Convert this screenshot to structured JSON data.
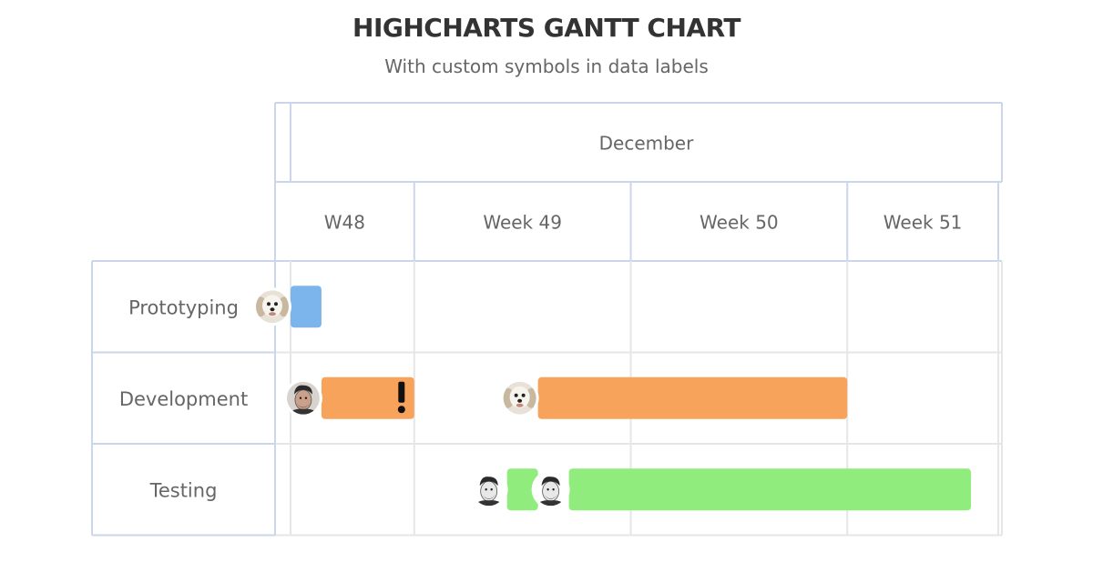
{
  "title": "HIGHCHARTS GANTT CHART",
  "subtitle": "With custom symbols in data labels",
  "chart_data": {
    "type": "gantt",
    "title": "HIGHCHARTS GANTT CHART",
    "subtitle": "With custom symbols in data labels",
    "month_label": "December",
    "week_labels": [
      "W48",
      "Week 49",
      "Week 50",
      "Week 51"
    ],
    "categories": [
      "Prototyping",
      "Development",
      "Testing"
    ],
    "grid": true,
    "x_range": [
      "2022-11-30T12:00",
      "2022-12-24T00:00"
    ],
    "tasks": [
      {
        "category": "Prototyping",
        "start": "2022-12-01",
        "end": "2022-12-02",
        "color": "#7cb5ec",
        "label_symbol": "dog-avatar-icon"
      },
      {
        "category": "Development",
        "start": "2022-12-02",
        "end": "2022-12-05",
        "color": "#f7a35c",
        "label_symbol": "man-avatar-icon",
        "end_symbol": "exclamation-icon"
      },
      {
        "category": "Development",
        "start": "2022-12-09",
        "end": "2022-12-19",
        "color": "#f7a35c",
        "label_symbol": "dog-avatar-icon"
      },
      {
        "category": "Testing",
        "start": "2022-12-08",
        "end": "2022-12-09",
        "color": "#90ed7d",
        "label_symbol": "man-avatar-icon"
      },
      {
        "category": "Testing",
        "start": "2022-12-10",
        "end": "2022-12-23",
        "color": "#90ed7d",
        "label_symbol": "man-avatar-icon"
      }
    ]
  }
}
